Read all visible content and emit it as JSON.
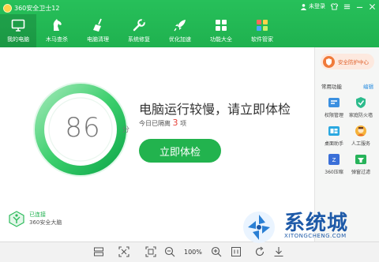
{
  "app": {
    "title": "360安全卫士12",
    "login": "未登录"
  },
  "nav": [
    {
      "label": "我的电脑",
      "icon": "monitor-icon",
      "active": true
    },
    {
      "label": "木马查杀",
      "icon": "horse-icon"
    },
    {
      "label": "电脑清理",
      "icon": "broom-icon"
    },
    {
      "label": "系统修复",
      "icon": "wrench-icon"
    },
    {
      "label": "优化加速",
      "icon": "rocket-icon"
    },
    {
      "label": "功能大全",
      "icon": "grid-icon"
    },
    {
      "label": "软件管家",
      "icon": "apps-icon"
    }
  ],
  "score": {
    "value": "86",
    "unit": "分"
  },
  "status": {
    "headline": "电脑运行较慢，请立即体检",
    "days_prefix": "今日已隔离",
    "days": "3",
    "days_suffix": "项"
  },
  "check_button": "立即体检",
  "brain": {
    "connected": "已连接",
    "name": "360安全大脑"
  },
  "side": {
    "center_button": "安全防护中心",
    "tools_title": "常用功能",
    "edit": "编辑",
    "tools": [
      {
        "label": "权限管理",
        "icon": "permission-icon"
      },
      {
        "label": "家庭防火墙",
        "icon": "firewall-icon"
      },
      {
        "label": "桌面助手",
        "icon": "desktop-icon"
      },
      {
        "label": "人工服务",
        "icon": "service-icon"
      },
      {
        "label": "360压缩",
        "icon": "compress-icon"
      },
      {
        "label": "弹窗过滤",
        "icon": "popup-filter-icon"
      }
    ]
  },
  "toolbar": {
    "zoom": "100%"
  },
  "watermark": {
    "text": "系统城",
    "url": "XITONGCHENG.COM"
  },
  "colors": {
    "brand": "#22b34e",
    "alert": "#e6423a",
    "watermark": "#1e5aa8"
  }
}
